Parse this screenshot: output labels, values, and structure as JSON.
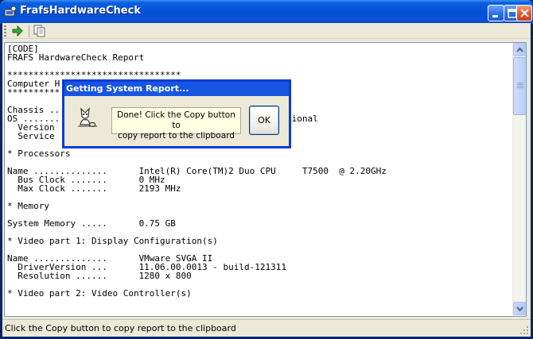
{
  "window": {
    "title": "FrafsHardwareCheck",
    "icons": {
      "app": "hardware-app-icon",
      "minimize": "minimize-icon",
      "maximize": "maximize-icon",
      "close": "close-icon"
    }
  },
  "toolbar": {
    "icons": {
      "run": "green-arrow-icon",
      "copy": "copy-icon"
    }
  },
  "report": {
    "lines": [
      "[CODE]",
      "FRAFS HardwareCheck Report",
      "",
      "*********************************",
      "Computer H",
      "**********",
      "",
      "Chassis ..",
      "OS .......                                           sional",
      "  Version",
      "  Service",
      "",
      "* Processors",
      "",
      "Name ..............      Intel(R) Core(TM)2 Duo CPU     T7500  @ 2.20GHz",
      "  Bus Clock .......      0 MHz",
      "  Max Clock .......      2193 MHz",
      "",
      "* Memory",
      "",
      "System Memory .....      0.75 GB",
      "",
      "* Video part 1: Display Configuration(s)",
      "",
      "Name ..............      VMware SVGA II",
      "  DriverVersion ...      11.06.00.0013 - build-121311",
      "  Resolution ......      1280 x 800",
      "",
      "* Video part 2: Video Controller(s)"
    ]
  },
  "status": {
    "text": "Click the Copy button to copy report to the clipboard"
  },
  "dialog": {
    "title": "Getting System Report...",
    "message_line1": "Done! Click the Copy button to",
    "message_line2": "copy report to the clipboard",
    "ok_label": "OK",
    "icon": "fox-mascot-icon"
  }
}
